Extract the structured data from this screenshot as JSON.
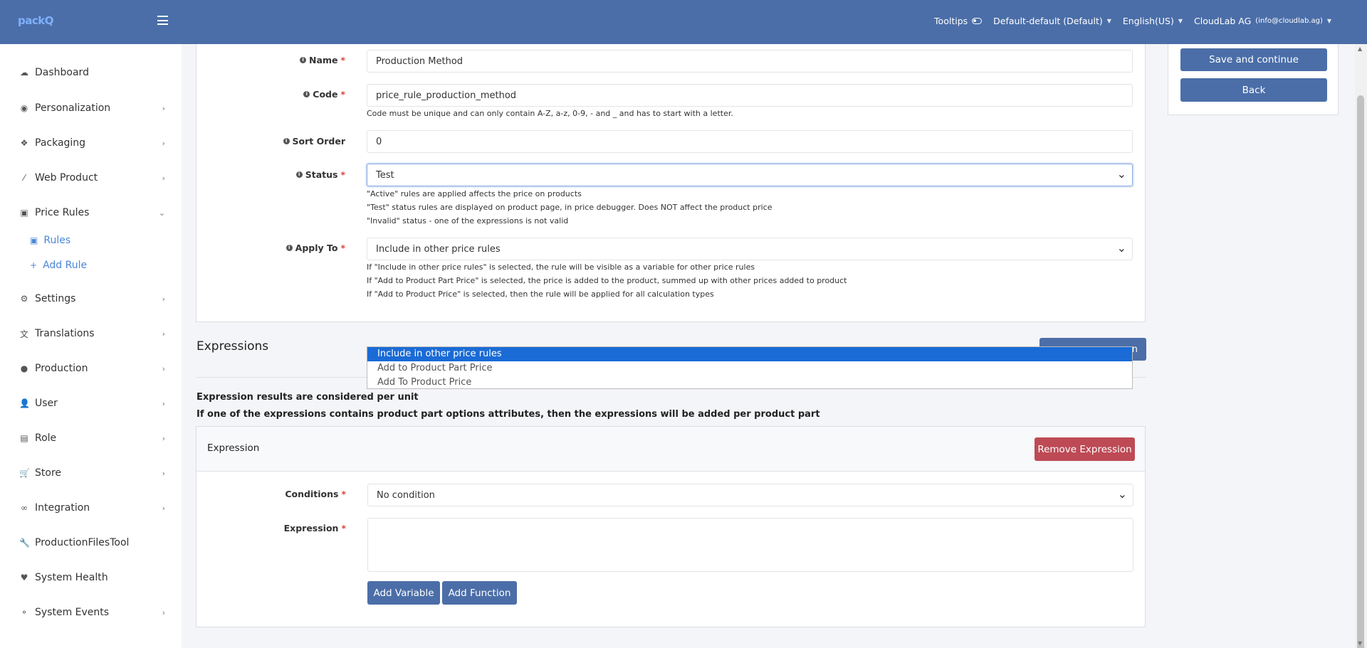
{
  "header": {
    "brand": "packQ",
    "tooltips_label": "Tooltips",
    "store_selector": "Default-default (Default)",
    "language": "English(US)",
    "account_name": "CloudLab AG",
    "account_email": "(info@cloudlab.ag)",
    "accent_color": "#4b6ea8"
  },
  "sidebar": {
    "items": [
      {
        "label": "Dashboard",
        "icon": "cloud-icon"
      },
      {
        "label": "Personalization",
        "icon": "eye-icon"
      },
      {
        "label": "Packaging",
        "icon": "dropbox-icon"
      },
      {
        "label": "Web Product",
        "icon": "wand-icon"
      },
      {
        "label": "Price Rules",
        "icon": "money-icon"
      },
      {
        "label": "Settings",
        "icon": "cogs-icon"
      },
      {
        "label": "Translations",
        "icon": "language-icon"
      },
      {
        "label": "Production",
        "icon": "production-icon"
      },
      {
        "label": "User",
        "icon": "user-icon"
      },
      {
        "label": "Role",
        "icon": "id-card-icon"
      },
      {
        "label": "Store",
        "icon": "cart-icon"
      },
      {
        "label": "Integration",
        "icon": "link-icon"
      },
      {
        "label": "ProductionFilesTool",
        "icon": "wrench-icon"
      },
      {
        "label": "System Health",
        "icon": "heartbeat-icon"
      },
      {
        "label": "System Events",
        "icon": "events-icon"
      }
    ],
    "price_rules_sub": [
      {
        "label": "Rules",
        "icon": "money-icon"
      },
      {
        "label": "Add Rule",
        "icon": "plus-icon"
      }
    ]
  },
  "form": {
    "name_label": "Name",
    "name_value": "Production Method",
    "code_label": "Code",
    "code_value": "price_rule_production_method",
    "code_help": "Code must be unique and can only contain A-Z, a-z, 0-9, - and _ and has to start with a letter.",
    "sort_label": "Sort Order",
    "sort_value": "0",
    "status_label": "Status",
    "status_value": "Test",
    "status_help_1": "\"Active\" rules are applied affects the price on products",
    "status_help_2": "\"Test\" status rules are displayed on product page, in price debugger. Does NOT affect the product price",
    "status_help_3": "\"Invalid\" status - one of the expressions is not valid",
    "apply_label": "Apply To",
    "apply_value": "Include in other price rules",
    "apply_help_1": "If \"Include in other price rules\" is selected, the rule will be visible as a variable for other price rules",
    "apply_help_2": "If \"Add to Product Part Price\" is selected, the price is added to the product, summed up with other prices added to product",
    "apply_help_3": "If \"Add to Product Price\" is selected, then the rule will be applied for all calculation types",
    "required_mark": "*"
  },
  "actions": {
    "save_continue": "Save and continue",
    "back": "Back"
  },
  "dropdown_options": [
    "Include in other price rules",
    "Add to Product Part Price",
    "Add To Product Price"
  ],
  "expressions": {
    "section_title": "Expressions",
    "hidden_button_tail": "n",
    "note_1": "Expression results are considered per unit",
    "note_2": "If one of the expressions contains product part options attributes, then the expressions will be added per product part",
    "card_title": "Expression",
    "remove_button": "Remove Expression",
    "conditions_label": "Conditions",
    "conditions_value": "No condition",
    "expression_label": "Expression",
    "add_variable": "Add Variable",
    "add_function": "Add Function"
  }
}
